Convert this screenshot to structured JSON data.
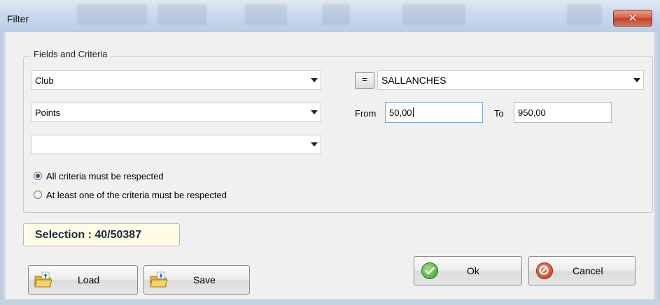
{
  "window": {
    "title": "Filter",
    "close_glyph": "✕"
  },
  "group": {
    "legend": "Fields and Criteria"
  },
  "criteria": {
    "field1": {
      "value": "Club",
      "operator": "=",
      "operand": "SALLANCHES"
    },
    "field2": {
      "value": "Points",
      "from_label": "From",
      "from_value": "50,00",
      "to_label": "To",
      "to_value": "950,00"
    },
    "field3": {
      "value": ""
    }
  },
  "logic": {
    "options": [
      {
        "label": "All criteria must be respected",
        "checked": true
      },
      {
        "label": "At least one of the criteria must be respected",
        "checked": false
      }
    ]
  },
  "selection": {
    "text": "Selection : 40/50387"
  },
  "buttons": {
    "load": "Load",
    "save": "Save",
    "ok": "Ok",
    "cancel": "Cancel"
  },
  "icons": {
    "load": "folder-open-icon",
    "save": "folder-save-icon",
    "ok": "check-circle-icon",
    "cancel": "no-entry-icon"
  },
  "colors": {
    "selection_bg": "#fffbe5",
    "ok_green": "#3a9a2a",
    "cancel_red": "#d0351c",
    "close_red": "#c0432a"
  }
}
